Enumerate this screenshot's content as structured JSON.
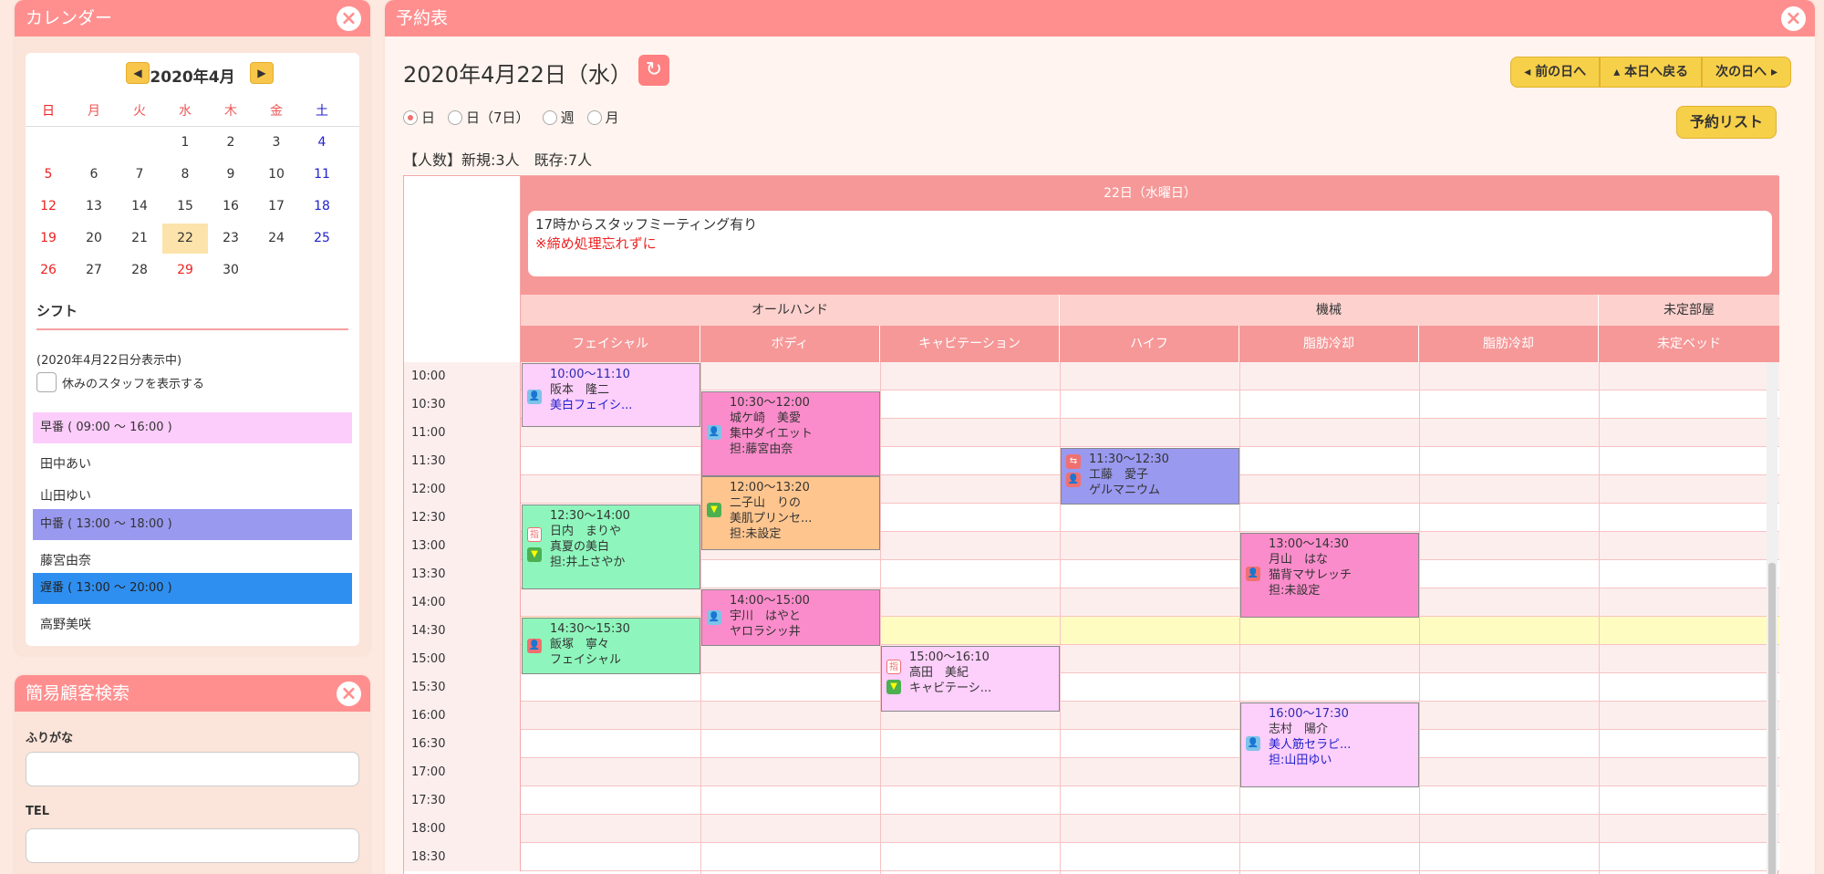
{
  "calendar": {
    "title": "カレンダー",
    "month": "2020年4月",
    "weekdays": [
      "日",
      "月",
      "火",
      "水",
      "木",
      "金",
      "土"
    ],
    "weeks": [
      [
        "",
        "",
        "",
        "1",
        "2",
        "3",
        "4"
      ],
      [
        "5",
        "6",
        "7",
        "8",
        "9",
        "10",
        "11"
      ],
      [
        "12",
        "13",
        "14",
        "15",
        "16",
        "17",
        "18"
      ],
      [
        "19",
        "20",
        "21",
        "22",
        "23",
        "24",
        "25"
      ],
      [
        "26",
        "27",
        "28",
        "29",
        "30",
        "",
        ""
      ]
    ],
    "shift_title": "シフト",
    "shift_sub": "(2020年4月22日分表示中)",
    "show_off_label": "休みのスタッフを表示する",
    "shifts": [
      {
        "label": "早番 ( 09:00 〜 16:00 )",
        "staff": [
          "田中あい",
          "山田ゆい"
        ]
      },
      {
        "label": "中番 ( 13:00 〜 18:00 )",
        "staff": [
          "藤宮由奈"
        ]
      },
      {
        "label": "遅番 ( 13:00 〜 20:00 )",
        "staff": [
          "高野美咲"
        ]
      }
    ]
  },
  "search": {
    "title": "簡易顧客検索",
    "kana_label": "ふりがな",
    "tel_label": "TEL"
  },
  "main": {
    "title": "予約表",
    "date": "2020年4月22日（水）",
    "prev_day": "前の日へ",
    "today": "本日へ戻る",
    "next_day": "次の日へ",
    "views": [
      "日",
      "日（7日）",
      "週",
      "月"
    ],
    "list_button": "予約リスト",
    "count": "【人数】新規:3人　既存:7人",
    "day_label": "22日（水曜日）",
    "memo_line1": "17時からスタッフミーティング有り",
    "memo_line2": "※締め処理忘れずに",
    "groups": [
      "オールハンド",
      "機械",
      "未定部屋"
    ],
    "columns": [
      "フェイシャル",
      "ボディ",
      "キャビテーション",
      "ハイフ",
      "脂肪冷却",
      "脂肪冷却",
      "未定ベッド"
    ],
    "times": [
      "10:00",
      "10:30",
      "11:00",
      "11:30",
      "12:00",
      "12:30",
      "13:00",
      "13:30",
      "14:00",
      "14:30",
      "15:00",
      "15:30",
      "16:00",
      "16:30",
      "17:00",
      "17:30",
      "18:00",
      "18:30"
    ],
    "appointments": [
      {
        "time": "10:00〜11:10",
        "name": "阪本　隆二",
        "l3": "美白フェイシ..."
      },
      {
        "time": "10:30〜12:00",
        "name": "城ケ崎　美愛",
        "l3": "集中ダイエット",
        "l4": "担:藤宮由奈"
      },
      {
        "time": "12:00〜13:20",
        "name": "二子山　りの",
        "l3": "美肌プリンセ...",
        "l4": "担:未設定"
      },
      {
        "time": "11:30〜12:30",
        "name": "工藤　愛子",
        "l3": "ゲルマニウム"
      },
      {
        "time": "12:30〜14:00",
        "name": "日内　まりや",
        "l3": "真夏の美白",
        "l4": "担:井上さやか"
      },
      {
        "time": "13:00〜14:30",
        "name": "月山　はな",
        "l3": "猫背マサレッチ",
        "l4": "担:未設定"
      },
      {
        "time": "14:00〜15:00",
        "name": "宇川　はやと",
        "l3": "ヤロラシッ井"
      },
      {
        "time": "14:30〜15:30",
        "name": "飯塚　寧々",
        "l3": "フェイシャル"
      },
      {
        "time": "15:00〜16:10",
        "name": "高田　美紀",
        "l3": "キャビテーシ..."
      },
      {
        "time": "16:00〜17:30",
        "name": "志村　陽介",
        "l3": "美人筋セラピ...",
        "l4": "担:山田ゆい"
      }
    ]
  },
  "colors": {
    "header": "#ff8f8f",
    "early": "#fccdfb",
    "mid": "#9999f0",
    "late": "#2f8ff0",
    "today_row": "#fffcc2"
  }
}
